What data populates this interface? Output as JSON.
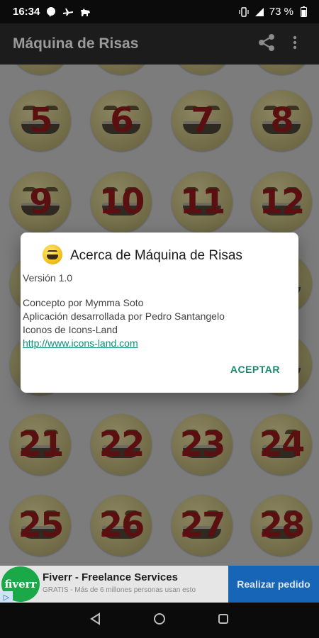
{
  "status_bar": {
    "time": "16:34",
    "battery": "73 %",
    "icons_left": [
      "chat-bubble-icon",
      "airplane-icon",
      "dog-icon"
    ],
    "icons_right": [
      "vibrate-icon",
      "signal-icon",
      "battery-icon"
    ]
  },
  "app_bar": {
    "title": "Máquina de Risas",
    "actions": [
      "share-icon",
      "overflow-menu-icon"
    ]
  },
  "grid": {
    "items": [
      "5",
      "6",
      "7",
      "8",
      "9",
      "10",
      "11",
      "12",
      "21",
      "22",
      "23",
      "24",
      "25",
      "26",
      "27",
      "28"
    ]
  },
  "dialog": {
    "title": "Acerca de Máquina de Risas",
    "version": "Versión 1.0",
    "lines": [
      "Concepto por Mymma Soto",
      "Aplicación desarrollada por Pedro Santangelo",
      "Iconos de Icons-Land"
    ],
    "link": "http://www.icons-land.com",
    "button": "ACEPTAR"
  },
  "ad": {
    "logo_text": "fiverr",
    "title": "Fiverr - Freelance Services",
    "subtitle": "GRATIS - Más de 6 millones personas usan esto",
    "cta": "Realizar pedido",
    "badge": "▷"
  },
  "nav_bar": {
    "buttons": [
      "back-icon",
      "home-icon",
      "recents-icon"
    ]
  },
  "colors": {
    "dialog_button": "#1b8a6f",
    "link": "#0b8e7a",
    "ad_cta": "#1765b6"
  }
}
